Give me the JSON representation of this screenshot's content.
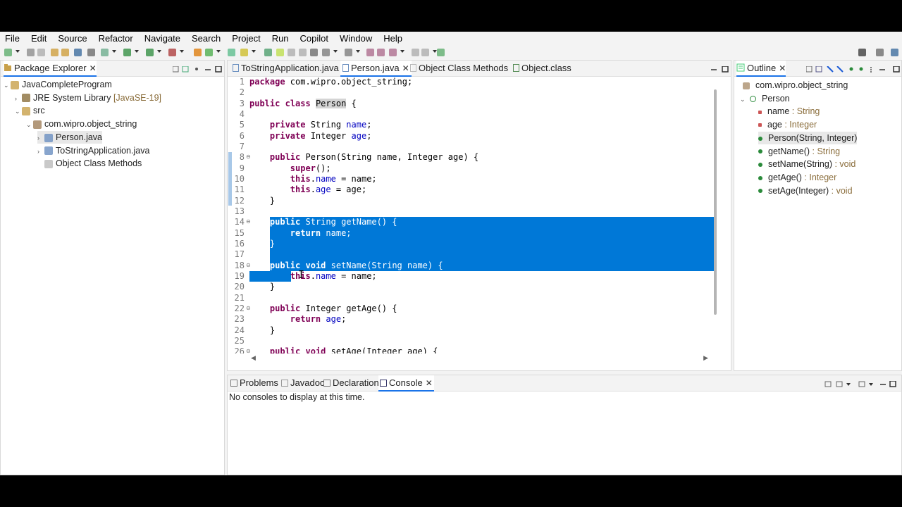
{
  "menu": [
    "File",
    "Edit",
    "Source",
    "Refactor",
    "Navigate",
    "Search",
    "Project",
    "Run",
    "Copilot",
    "Window",
    "Help"
  ],
  "package_explorer": {
    "tab_label": "Package Explorer",
    "close": "✕",
    "tree": [
      {
        "label": "JavaCompleteProgram",
        "indent": 0,
        "chevron": "⌄",
        "icon": "project-icon"
      },
      {
        "label": "JRE System Library",
        "extra": "[JavaSE-19]",
        "indent": 1,
        "chevron": "›",
        "icon": "library-icon"
      },
      {
        "label": "src",
        "indent": 1,
        "chevron": "⌄",
        "icon": "source-folder-icon"
      },
      {
        "label": "com.wipro.object_string",
        "indent": 2,
        "chevron": "⌄",
        "icon": "package-icon"
      },
      {
        "label": "Person.java",
        "indent": 3,
        "chevron": "›",
        "icon": "java-file-icon",
        "selected": true
      },
      {
        "label": "ToStringApplication.java",
        "indent": 3,
        "chevron": "›",
        "icon": "java-file-icon"
      },
      {
        "label": "Object Class Methods",
        "indent": 3,
        "chevron": "",
        "icon": "text-file-icon"
      }
    ]
  },
  "editor": {
    "tabs": [
      {
        "label": "ToStringApplication.java",
        "icon": "java-file-icon"
      },
      {
        "label": "Person.java",
        "icon": "java-file-icon",
        "active": true,
        "close": "✕"
      },
      {
        "label": "Object Class Methods",
        "icon": "text-file-icon"
      },
      {
        "label": "Object.class",
        "icon": "class-file-icon"
      }
    ],
    "lines": [
      {
        "n": "1",
        "code": "package com.wipro.object_string;"
      },
      {
        "n": "2",
        "code": ""
      },
      {
        "n": "3",
        "code": "public class Person {"
      },
      {
        "n": "4",
        "code": ""
      },
      {
        "n": "5",
        "code": "    private String name;"
      },
      {
        "n": "6",
        "code": "    private Integer age;"
      },
      {
        "n": "7",
        "code": ""
      },
      {
        "n": "8",
        "code": "    public Person(String name, Integer age) {"
      },
      {
        "n": "9",
        "code": "        super();"
      },
      {
        "n": "10",
        "code": "        this.name = name;"
      },
      {
        "n": "11",
        "code": "        this.age = age;"
      },
      {
        "n": "12",
        "code": "    }"
      },
      {
        "n": "13",
        "code": ""
      },
      {
        "n": "14",
        "code": "    public String getName() {"
      },
      {
        "n": "15",
        "code": "        return name;"
      },
      {
        "n": "16",
        "code": "    }"
      },
      {
        "n": "17",
        "code": ""
      },
      {
        "n": "18",
        "code": "    public void setName(String name) {"
      },
      {
        "n": "19",
        "code": "        this.name = name;"
      },
      {
        "n": "20",
        "code": "    }"
      },
      {
        "n": "21",
        "code": ""
      },
      {
        "n": "22",
        "code": "    public Integer getAge() {"
      },
      {
        "n": "23",
        "code": "        return age;"
      },
      {
        "n": "24",
        "code": "    }"
      },
      {
        "n": "25",
        "code": ""
      },
      {
        "n": "26",
        "code": "    public void setAge(Integer age) {"
      }
    ],
    "selection_color": "#0078d7"
  },
  "outline": {
    "tab_label": "Outline",
    "close": "✕",
    "items": [
      {
        "label": "com.wipro.object_string",
        "type": "",
        "icon": "package-icon",
        "indent": 0
      },
      {
        "label": "Person",
        "type": "",
        "icon": "class-icon",
        "indent": 0,
        "chevron": "⌄"
      },
      {
        "label": "name",
        "type": " : String",
        "icon": "private-field-icon",
        "indent": 1
      },
      {
        "label": "age",
        "type": " : Integer",
        "icon": "private-field-icon",
        "indent": 1
      },
      {
        "label": "Person(String, Integer)",
        "type": "",
        "icon": "constructor-icon",
        "indent": 1,
        "selected": true
      },
      {
        "label": "getName()",
        "type": " : String",
        "icon": "public-method-icon",
        "indent": 1
      },
      {
        "label": "setName(String)",
        "type": " : void",
        "icon": "public-method-icon",
        "indent": 1
      },
      {
        "label": "getAge()",
        "type": " : Integer",
        "icon": "public-method-icon",
        "indent": 1
      },
      {
        "label": "setAge(Integer)",
        "type": " : void",
        "icon": "public-method-icon",
        "indent": 1
      }
    ]
  },
  "bottom": {
    "tabs": [
      {
        "label": "Problems",
        "icon": "problems-icon"
      },
      {
        "label": "Javadoc",
        "icon": "javadoc-icon"
      },
      {
        "label": "Declaration",
        "icon": "declaration-icon"
      },
      {
        "label": "Console",
        "icon": "console-icon",
        "active": true,
        "close": "✕"
      }
    ],
    "message": "No consoles to display at this time."
  }
}
